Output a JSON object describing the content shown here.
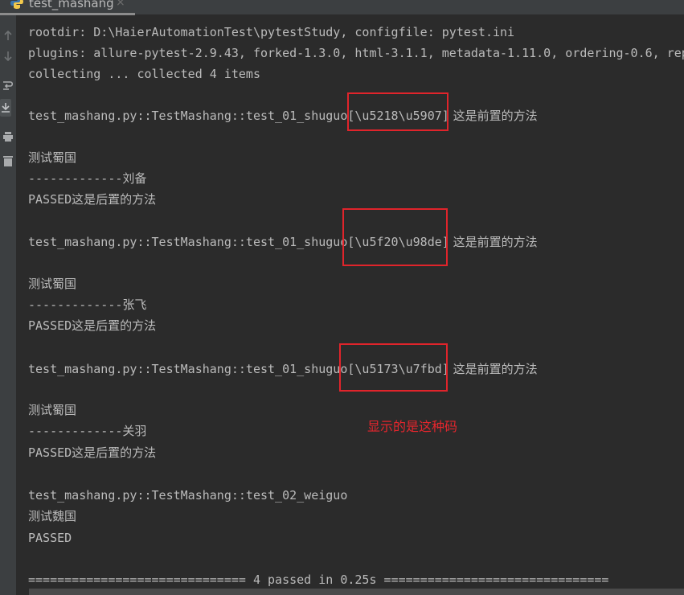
{
  "tab": {
    "label": "test_mashang",
    "icon": "python-icon",
    "close": "×"
  },
  "gutter": {
    "icons": [
      "arrow-up-icon",
      "arrow-down-icon",
      "soft-wrap-icon",
      "scroll-to-end-icon",
      "print-icon",
      "trash-icon"
    ]
  },
  "console": {
    "lines": [
      {
        "text": "rootdir: D:\\HaierAutomationTest\\pytestStudy, configfile: pytest.ini"
      },
      {
        "text": "plugins: allure-pytest-2.9.43, forked-1.3.0, html-3.1.1, metadata-1.11.0, ordering-0.6, rep"
      },
      {
        "text": "collecting ... collected 4 items"
      },
      {
        "text": ""
      },
      {
        "prefix": "test_mashang.py::TestMashang::test_01_shuguo",
        "param": "[\\u5218\\u5907]",
        "suffix": " 这是前置的方法"
      },
      {
        "text": ""
      },
      {
        "text": "测试蜀国"
      },
      {
        "text": "-------------刘备"
      },
      {
        "text": "PASSED这是后置的方法"
      },
      {
        "text": ""
      },
      {
        "prefix": "test_mashang.py::TestMashang::test_01_shuguo",
        "param": "[\\u5f20\\u98de]",
        "suffix": " 这是前置的方法"
      },
      {
        "text": ""
      },
      {
        "text": "测试蜀国"
      },
      {
        "text": "-------------张飞"
      },
      {
        "text": "PASSED这是后置的方法"
      },
      {
        "text": ""
      },
      {
        "prefix": "test_mashang.py::TestMashang::test_01_shuguo",
        "param": "[\\u5173\\u7fbd]",
        "suffix": " 这是前置的方法"
      },
      {
        "text": ""
      },
      {
        "text": "测试蜀国"
      },
      {
        "text": "-------------关羽"
      },
      {
        "text": "PASSED这是后置的方法"
      },
      {
        "text": ""
      },
      {
        "text": "test_mashang.py::TestMashang::test_02_weiguo"
      },
      {
        "text": "测试魏国"
      },
      {
        "text": "PASSED"
      },
      {
        "text": ""
      },
      {
        "text": "============================== 4 passed in 0.25s ==============================="
      }
    ]
  },
  "annotation": {
    "text": "显示的是这种码",
    "color": "#e5262d"
  },
  "colors": {
    "background": "#2b2b2b",
    "text": "#bbbbbb",
    "highlight": "#e0242b"
  }
}
